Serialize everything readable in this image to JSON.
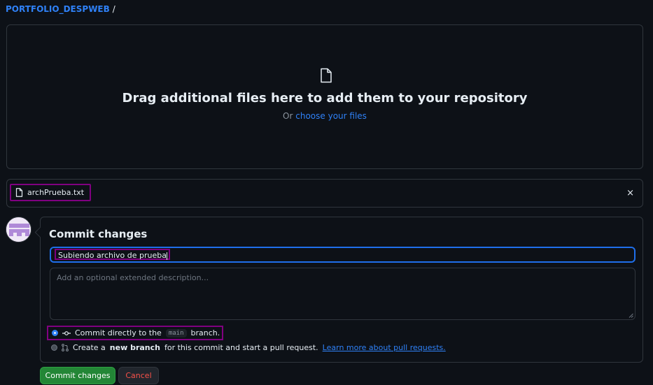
{
  "breadcrumb": {
    "repo": "PORTFOLIO_DESPWEB",
    "separator": "/"
  },
  "dropzone": {
    "heading": "Drag additional files here to add them to your repository",
    "or_text": "Or",
    "choose_link": "choose your files"
  },
  "uploaded_file": {
    "name": "archPrueba.txt",
    "remove_glyph": "×"
  },
  "commit": {
    "title": "Commit changes",
    "summary_value": "Subiendo archivo de prueba",
    "description_placeholder": "Add an optional extended description...",
    "option_direct": {
      "prefix": "Commit directly to the",
      "branch": "main",
      "suffix": "branch.",
      "selected": true
    },
    "option_new_branch": {
      "prefix": "Create a",
      "bold": "new branch",
      "suffix": "for this commit and start a pull request.",
      "link": "Learn more about pull requests.",
      "selected": false
    }
  },
  "buttons": {
    "commit": "Commit changes",
    "cancel": "Cancel"
  },
  "colors": {
    "accent": "#2f81f7",
    "primary_button": "#238636",
    "danger": "#f85149",
    "highlight_box": "#800080"
  },
  "icons": [
    "file-icon",
    "close-icon",
    "commit-icon",
    "pull-request-icon",
    "avatar"
  ]
}
